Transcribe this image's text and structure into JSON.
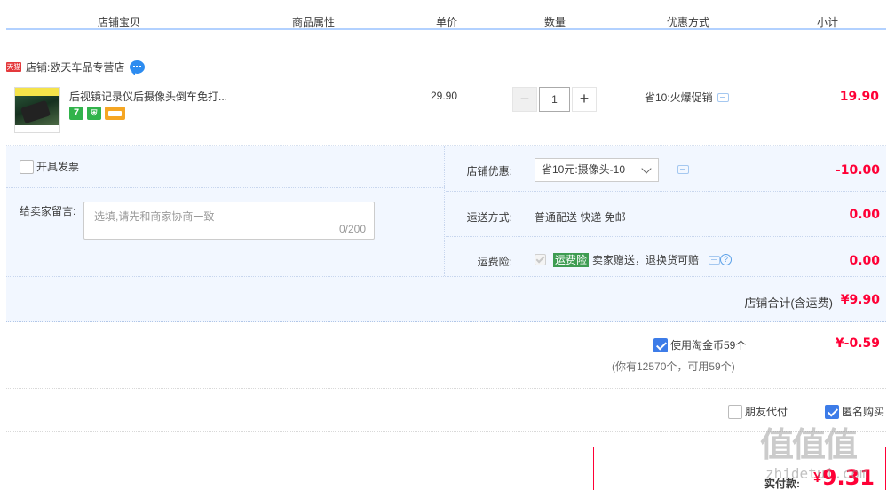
{
  "header": {
    "cols": [
      "店铺宝贝",
      "商品属性",
      "单价",
      "数量",
      "优惠方式",
      "小计"
    ]
  },
  "shop": {
    "badge": "天猫",
    "label": "店铺:",
    "name": "欧天车品专营店"
  },
  "item": {
    "title": "后视镜记录仪后摄像头倒车免打...",
    "unit_price": "29.90",
    "qty": "1",
    "qty_minus": "−",
    "qty_plus": "+",
    "promo": "省10:火爆促销",
    "subtotal": "19.90",
    "tags": [
      "7",
      "⛨",
      "card"
    ]
  },
  "options": {
    "invoice_label": "开具发票",
    "message_label": "给卖家留言:",
    "message_placeholder": "选填,请先和商家协商一致",
    "message_count": "0/200",
    "coupon_label": "店铺优惠:",
    "coupon_value": "省10元:摄像头-10",
    "coupon_amount": "-10.00",
    "shipping_label": "运送方式:",
    "shipping_value": "普通配送 快递 免邮",
    "shipping_amount": "0.00",
    "insurance_label": "运费险:",
    "insurance_badge": "运费险",
    "insurance_text": "卖家赠送，退换货可赔",
    "insurance_amount": "0.00"
  },
  "shop_total": {
    "label": "店铺合计(含运费)",
    "value": "¥9.90"
  },
  "coins": {
    "label": "使用淘金币59个",
    "amount": "¥-0.59",
    "note": "(你有12570个，可用59个)"
  },
  "pay_options": {
    "friend_pay": "朋友代付",
    "anonymous": "匿名购买"
  },
  "final": {
    "label": "实付款:",
    "currency": "¥",
    "value": "9.31"
  },
  "watermark": {
    "top": "值值值",
    "bottom": "zhidetui.com"
  },
  "colors": {
    "accent_red": "#ff0036",
    "header_line": "#b2d1ff",
    "panel_bg": "#f2f7ff",
    "checkbox_blue": "#3d7ce8",
    "insurance_green": "#3e9c52"
  }
}
